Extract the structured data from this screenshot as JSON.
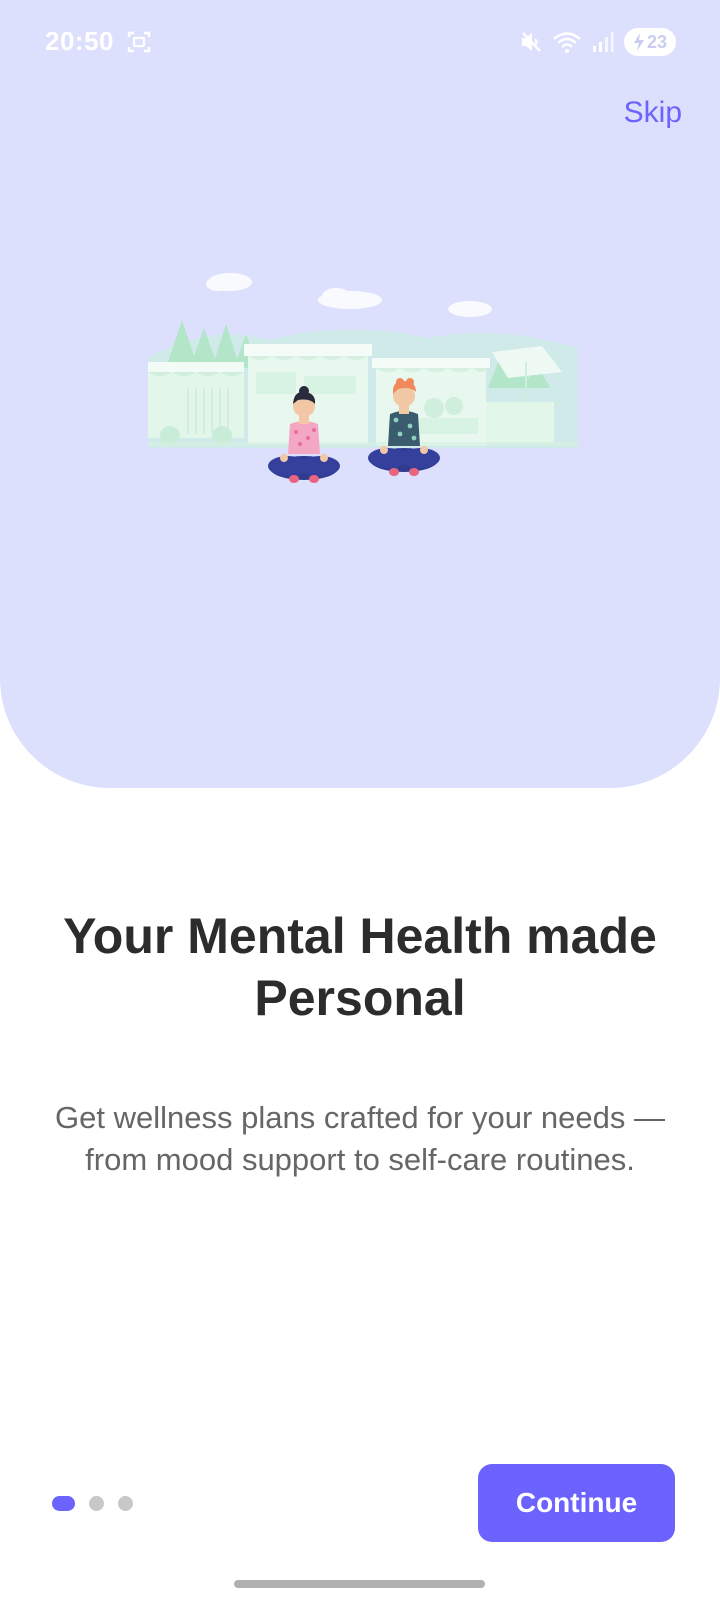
{
  "status_bar": {
    "time": "20:50",
    "battery_level": "23",
    "icons": [
      "screenshot-icon",
      "mute-icon",
      "wifi-icon",
      "signal-icon",
      "battery-icon"
    ]
  },
  "onboarding": {
    "skip_label": "Skip",
    "title": "Your Mental Health made Personal",
    "subtitle": "Get wellness plans crafted for your needs — from mood support to self-care routines.",
    "continue_label": "Continue",
    "page_count": 3,
    "active_page": 1
  },
  "colors": {
    "accent": "#6c63ff",
    "hero_background": "#dce0fd",
    "title_text": "#2c2c2c",
    "body_text": "#666666",
    "inactive_dot": "#c8c8c8"
  }
}
